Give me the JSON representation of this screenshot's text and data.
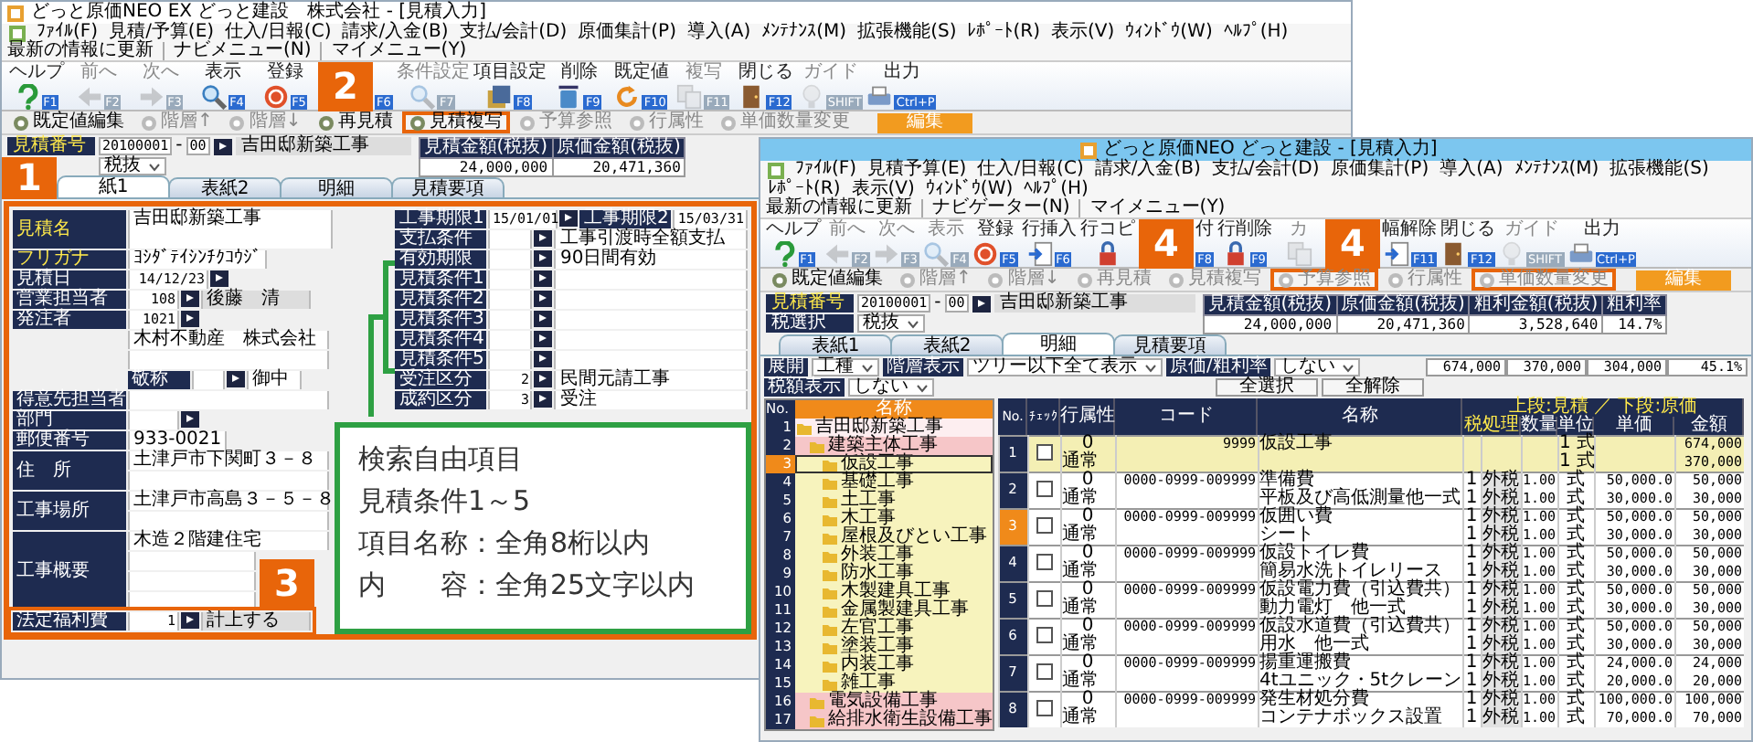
{
  "left_window": {
    "title": "どっと原価NEO EX どっと建設　株式会社 - [見積入力]",
    "menu": [
      "ﾌｧｲﾙ(F)",
      "見積/予算(E)",
      "仕入/日報(C)",
      "請求/入金(B)",
      "支払/会計(D)",
      "原価集計(P)",
      "導入(A)",
      "ﾒﾝﾃﾅﾝｽ(M)",
      "拡張機能(S)",
      "ﾚﾎﾟｰﾄ(R)",
      "表示(V)",
      "ｳｨﾝﾄﾞｳ(W)",
      "ﾍﾙﾌﾟ(H)"
    ],
    "nav": [
      "最新の情報に更新",
      "ナビメニュー(N)",
      "マイメニュー(Y)"
    ],
    "toolbar": [
      {
        "label": "ヘルプ",
        "key": "F1",
        "disabled": false
      },
      {
        "label": "前へ",
        "key": "F2",
        "disabled": true
      },
      {
        "label": "次へ",
        "key": "F3",
        "disabled": true
      },
      {
        "label": "表示",
        "key": "F4",
        "disabled": false
      },
      {
        "label": "登録",
        "key": "F5",
        "disabled": false
      },
      {
        "key": "F6",
        "disabled": false,
        "callout": "2"
      },
      {
        "label": "条件設定",
        "key": "F7",
        "disabled": true
      },
      {
        "label": "項目設定",
        "key": "F8",
        "disabled": false
      },
      {
        "label": "削除",
        "key": "F9",
        "disabled": false
      },
      {
        "label": "既定値",
        "key": "F10",
        "disabled": false
      },
      {
        "label": "複写",
        "key": "F11",
        "disabled": true
      },
      {
        "label": "閉じる",
        "key": "F12",
        "disabled": false
      },
      {
        "label": "ガイド",
        "key": "SHIFT",
        "disabled": true
      },
      {
        "label": "出力",
        "key": "Ctrl+P",
        "disabled": false
      }
    ],
    "actions": [
      {
        "label": "既定値編集",
        "disabled": false,
        "highlighted": false
      },
      {
        "label": "階層↑",
        "disabled": true,
        "highlighted": false
      },
      {
        "label": "階層↓",
        "disabled": true,
        "highlighted": false
      },
      {
        "label": "再見積",
        "disabled": false,
        "highlighted": false
      },
      {
        "label": "見積複写",
        "disabled": false,
        "highlighted": true
      },
      {
        "label": "予算参照",
        "disabled": true,
        "highlighted": false
      },
      {
        "label": "行属性",
        "disabled": true,
        "highlighted": false
      },
      {
        "label": "単価数量変更",
        "disabled": true,
        "highlighted": false
      }
    ],
    "edit_button": "編集",
    "header": {
      "number_label": "見積番号",
      "number": "20100001",
      "separator": "-",
      "branch": "00",
      "name": "吉田邸新築工事",
      "tax_select": "税抜",
      "totals": [
        {
          "label": "見積金額(税抜)",
          "value": "24,000,000"
        },
        {
          "label": "原価金額(税抜)",
          "value": "20,471,360"
        }
      ]
    },
    "tabs": [
      {
        "label": "紙1",
        "selected": true
      },
      {
        "label": "表紙2",
        "selected": false
      },
      {
        "label": "明細",
        "selected": false
      },
      {
        "label": "見積要項",
        "selected": false
      }
    ],
    "form": {
      "highlighted": true,
      "callout": "1",
      "left_fields": [
        {
          "label": "見積名",
          "kind": "tall",
          "value": "吉田邸新築工事",
          "required": true,
          "highlighted": false
        },
        {
          "label": "フリガナ",
          "kind": "text",
          "value": "ﾖｼﾀﾞﾃｲｼﾝﾁｸｺｳｼﾞ",
          "required": true,
          "highlighted": false
        },
        {
          "label": "見積日",
          "kind": "date",
          "value": "14/12/23",
          "required": false,
          "highlighted": false
        },
        {
          "label": "営業担当者",
          "kind": "code",
          "code": "108",
          "value": "後藤　清",
          "required": false,
          "highlighted": false
        },
        {
          "label": "発注者",
          "kind": "customer",
          "code": "1021",
          "lines": [
            "木村不動産　株式会社"
          ],
          "honorific_label": "敬称",
          "honorific": "御中",
          "required": false,
          "highlighted": false
        },
        {
          "label": "得意先担当者",
          "kind": "text",
          "required": false,
          "highlighted": false
        },
        {
          "label": "部門",
          "kind": "code",
          "required": false,
          "highlighted": false
        },
        {
          "label": "郵便番号",
          "kind": "text",
          "value": "933-0021",
          "required": false,
          "highlighted": false
        },
        {
          "label": "住　所",
          "kind": "two_line",
          "lines": [
            "土津戸市下関町３－８"
          ],
          "required": false,
          "highlighted": false
        },
        {
          "label": "工事場所",
          "kind": "two_line",
          "lines": [
            "土津戸市高島３－５－８"
          ],
          "required": false,
          "highlighted": false
        },
        {
          "label": "工事概要",
          "kind": "four_line",
          "lines": [
            "木造２階建住宅"
          ],
          "required": false,
          "highlighted": false
        },
        {
          "label": "法定福利費",
          "kind": "code",
          "code": "1",
          "value": "計上する",
          "required": false,
          "highlighted": true,
          "callout": "3"
        }
      ],
      "right_fields": [
        {
          "label": "工事期限1",
          "kind": "period",
          "value": "15/01/01",
          "label2": "工事期限2",
          "value2": "15/03/31"
        },
        {
          "label": "支払条件",
          "kind": "code",
          "value": "工事引渡時全額支払"
        },
        {
          "label": "有効期限",
          "kind": "code",
          "value": "90日間有効"
        },
        {
          "label": "見積条件1",
          "kind": "free"
        },
        {
          "label": "見積条件2",
          "kind": "free"
        },
        {
          "label": "見積条件3",
          "kind": "free"
        },
        {
          "label": "見積条件4",
          "kind": "free"
        },
        {
          "label": "見積条件5",
          "kind": "free"
        },
        {
          "label": "受注区分",
          "kind": "code",
          "code": "2",
          "value": "民間元請工事"
        },
        {
          "label": "成約区分",
          "kind": "code",
          "code": "3",
          "value": "受注"
        }
      ]
    },
    "note": {
      "lines": [
        "検索自由項目",
        "見積条件1～5",
        "項目名称：全角8桁以内",
        "内　　容：全角25文字以内"
      ]
    }
  },
  "right_window": {
    "title": "どっと原価NEO どっと建設 - [見積入力]",
    "menu": [
      "ﾌｧｲﾙ(F)",
      "見積予算(E)",
      "仕入/日報(C)",
      "請求/入金(B)",
      "支払/会計(D)",
      "原価集計(P)",
      "導入(A)",
      "ﾒﾝﾃﾅﾝｽ(M)",
      "拡張機能(S)",
      "ﾚﾎﾟｰﾄ(R)",
      "表示(V)",
      "ｳｨﾝﾄﾞｳ(W)",
      "ﾍﾙﾌﾟ(H)"
    ],
    "nav": [
      "最新の情報に更新",
      "ナビゲーター(N)",
      "マイメニュー(Y)"
    ],
    "toolbar": [
      {
        "label": "ヘルプ",
        "key": "F1",
        "disabled": false
      },
      {
        "label": "前へ",
        "key": "F2",
        "disabled": true
      },
      {
        "label": "次へ",
        "key": "F3",
        "disabled": true
      },
      {
        "label": "表示",
        "key": "F4",
        "disabled": true
      },
      {
        "label": "登録",
        "key": "F5",
        "disabled": false
      },
      {
        "label": "行挿入",
        "key": "F6",
        "disabled": false
      },
      {
        "label": "行コピ",
        "disabled": false
      },
      {
        "label": "付",
        "key": "F8",
        "disabled": false,
        "callout": "4"
      },
      {
        "label": "行削除",
        "key": "F9",
        "disabled": false
      },
      {
        "label": "カ",
        "disabled": true
      },
      {
        "label": "幅解除",
        "key": "F11",
        "disabled": false,
        "callout": "4"
      },
      {
        "label": "閉じる",
        "key": "F12",
        "disabled": false
      },
      {
        "label": "ガイド",
        "key": "SHIFT",
        "disabled": true
      },
      {
        "label": "出力",
        "key": "Ctrl+P",
        "disabled": false
      }
    ],
    "actions": [
      {
        "label": "既定値編集",
        "disabled": false,
        "highlighted": false
      },
      {
        "label": "階層↑",
        "disabled": true,
        "highlighted": false
      },
      {
        "label": "階層↓",
        "disabled": true,
        "highlighted": false
      },
      {
        "label": "再見積",
        "disabled": true,
        "highlighted": false
      },
      {
        "label": "見積複写",
        "disabled": true,
        "highlighted": false
      },
      {
        "label": "予算参照",
        "disabled": true,
        "highlighted": true
      },
      {
        "label": "行属性",
        "disabled": true,
        "highlighted": false
      },
      {
        "label": "単価数量変更",
        "disabled": true,
        "highlighted": true
      }
    ],
    "edit_button": "編集",
    "header": {
      "number_label": "見積番号",
      "number": "20100001",
      "separator": "-",
      "branch": "00",
      "name": "吉田邸新築工事",
      "tax_label": "税選択",
      "tax_select": "税抜",
      "totals": [
        {
          "label": "見積金額(税抜)",
          "value": "24,000,000"
        },
        {
          "label": "原価金額(税抜)",
          "value": "20,471,360"
        },
        {
          "label": "粗利金額(税抜)",
          "value": "3,528,640"
        },
        {
          "label": "粗利率",
          "value": "14.7%"
        }
      ]
    },
    "tabs": [
      {
        "label": "表紙1",
        "selected": false
      },
      {
        "label": "表紙2",
        "selected": false
      },
      {
        "label": "明細",
        "selected": true
      },
      {
        "label": "見積要項",
        "selected": false
      }
    ],
    "detail": {
      "filters": [
        {
          "label": "展開",
          "value": "工種"
        },
        {
          "label": "階層表示",
          "value": "ツリー以下全て表示"
        },
        {
          "label": "原価/粗利率",
          "value": "しない"
        },
        {
          "label": "税額表示",
          "value": "しない"
        }
      ],
      "buttons": [
        "全選択",
        "全解除"
      ],
      "subtotals": [
        "674,000",
        "370,000",
        "304,000",
        "45.1%"
      ],
      "tree": {
        "columns": [
          "No.",
          "名称"
        ],
        "items": [
          {
            "no": "1",
            "name": "吉田邸新築工事",
            "selected": false,
            "children": [
              {
                "no": "2",
                "name": "建築主体工事",
                "selected": false,
                "children": [
                  {
                    "no": "3",
                    "name": "仮設工事",
                    "selected": true
                  },
                  {
                    "no": "4",
                    "name": "基礎工事",
                    "selected": false
                  },
                  {
                    "no": "5",
                    "name": "土工事",
                    "selected": false
                  },
                  {
                    "no": "6",
                    "name": "木工事",
                    "selected": false
                  },
                  {
                    "no": "7",
                    "name": "屋根及びとい工事",
                    "selected": false
                  },
                  {
                    "no": "8",
                    "name": "外装工事",
                    "selected": false
                  },
                  {
                    "no": "9",
                    "name": "防水工事",
                    "selected": false
                  },
                  {
                    "no": "10",
                    "name": "木製建具工事",
                    "selected": false
                  },
                  {
                    "no": "11",
                    "name": "金属製建具工事",
                    "selected": false
                  },
                  {
                    "no": "12",
                    "name": "左官工事",
                    "selected": false
                  },
                  {
                    "no": "13",
                    "name": "塗装工事",
                    "selected": false
                  },
                  {
                    "no": "14",
                    "name": "内装工事",
                    "selected": false
                  },
                  {
                    "no": "15",
                    "name": "雑工事",
                    "selected": false
                  }
                ]
              },
              {
                "no": "16",
                "name": "電気設備工事",
                "selected": false
              },
              {
                "no": "17",
                "name": "給排水衛生設備工事",
                "selected": false
              }
            ]
          }
        ]
      },
      "table": {
        "columns": [
          "No.",
          "ﾁｪｯｸ",
          "行属性",
          "コード",
          "名称"
        ],
        "group_header": "上段:見積 ／ 下段:原価",
        "subcolumns": [
          "税処理",
          "数量",
          "単位",
          "単価",
          "金額"
        ],
        "rows": [
          {
            "no": "1",
            "kind": "group",
            "selected": false,
            "checked": false,
            "attr": "0",
            "attr_type": "通常",
            "code": "9999",
            "lines": [
              {
                "name": "仮設工事",
                "unit": "1 式",
                "amount": "674,000"
              },
              {
                "unit": "1 式",
                "amount": "370,000"
              }
            ]
          },
          {
            "no": "2",
            "kind": "item",
            "selected": false,
            "checked": false,
            "attr": "0",
            "attr_type": "通常",
            "code": "0000-0999-009999",
            "lines": [
              {
                "name": "準備費",
                "tax_code": "1",
                "tax": "外税",
                "qty": "1.00",
                "unit": "式",
                "price": "50,000.0",
                "amount": "50,000"
              },
              {
                "name": "平板及び高低測量他一式",
                "tax_code": "1",
                "tax": "外税",
                "qty": "1.00",
                "unit": "式",
                "price": "30,000.0",
                "amount": "30,000"
              }
            ]
          },
          {
            "no": "3",
            "kind": "item",
            "selected": true,
            "checked": false,
            "attr": "0",
            "attr_type": "通常",
            "code": "0000-0999-009999",
            "lines": [
              {
                "name": "仮囲い費",
                "tax_code": "1",
                "tax": "外税",
                "qty": "1.00",
                "unit": "式",
                "price": "50,000.0",
                "amount": "50,000"
              },
              {
                "name": "シート",
                "tax_code": "1",
                "tax": "外税",
                "qty": "1.00",
                "unit": "式",
                "price": "30,000.0",
                "amount": "30,000"
              }
            ]
          },
          {
            "no": "4",
            "kind": "item",
            "selected": false,
            "checked": false,
            "attr": "0",
            "attr_type": "通常",
            "code": "0000-0999-009999",
            "lines": [
              {
                "name": "仮設トイレ費",
                "tax_code": "1",
                "tax": "外税",
                "qty": "1.00",
                "unit": "式",
                "price": "50,000.0",
                "amount": "50,000"
              },
              {
                "name": "簡易水洗トイレリース",
                "tax_code": "1",
                "tax": "外税",
                "qty": "1.00",
                "unit": "式",
                "price": "30,000.0",
                "amount": "30,000"
              }
            ]
          },
          {
            "no": "5",
            "kind": "item",
            "selected": false,
            "checked": false,
            "attr": "0",
            "attr_type": "通常",
            "code": "0000-0999-009999",
            "lines": [
              {
                "name": "仮設電力費（引込費共）",
                "tax_code": "1",
                "tax": "外税",
                "qty": "1.00",
                "unit": "式",
                "price": "50,000.0",
                "amount": "50,000"
              },
              {
                "name": "動力電灯　他一式",
                "tax_code": "1",
                "tax": "外税",
                "qty": "1.00",
                "unit": "式",
                "price": "30,000.0",
                "amount": "30,000"
              }
            ]
          },
          {
            "no": "6",
            "kind": "item",
            "selected": false,
            "checked": false,
            "attr": "0",
            "attr_type": "通常",
            "code": "0000-0999-009999",
            "lines": [
              {
                "name": "仮設水道費（引込費共）",
                "tax_code": "1",
                "tax": "外税",
                "qty": "1.00",
                "unit": "式",
                "price": "50,000.0",
                "amount": "50,000"
              },
              {
                "name": "用水　他一式",
                "tax_code": "1",
                "tax": "外税",
                "qty": "1.00",
                "unit": "式",
                "price": "30,000.0",
                "amount": "30,000"
              }
            ]
          },
          {
            "no": "7",
            "kind": "item",
            "selected": false,
            "checked": false,
            "attr": "0",
            "attr_type": "通常",
            "code": "0000-0999-009999",
            "lines": [
              {
                "name": "揚重運搬費",
                "tax_code": "1",
                "tax": "外税",
                "qty": "1.00",
                "unit": "式",
                "price": "24,000.0",
                "amount": "24,000"
              },
              {
                "name": "4tユニック・5tクレーン",
                "tax_code": "1",
                "tax": "外税",
                "qty": "1.00",
                "unit": "式",
                "price": "20,000.0",
                "amount": "20,000"
              }
            ]
          },
          {
            "no": "8",
            "kind": "item",
            "selected": false,
            "checked": false,
            "attr": "0",
            "attr_type": "通常",
            "code": "0000-0999-009999",
            "lines": [
              {
                "name": "発生材処分費",
                "tax_code": "1",
                "tax": "外税",
                "qty": "1.00",
                "unit": "式",
                "price": "100,000.0",
                "amount": "100,000"
              },
              {
                "name": "コンテナボックス設置",
                "tax_code": "1",
                "tax": "外税",
                "qty": "1.00",
                "unit": "式",
                "price": "70,000.0",
                "amount": "70,000"
              }
            ]
          }
        ]
      }
    }
  }
}
